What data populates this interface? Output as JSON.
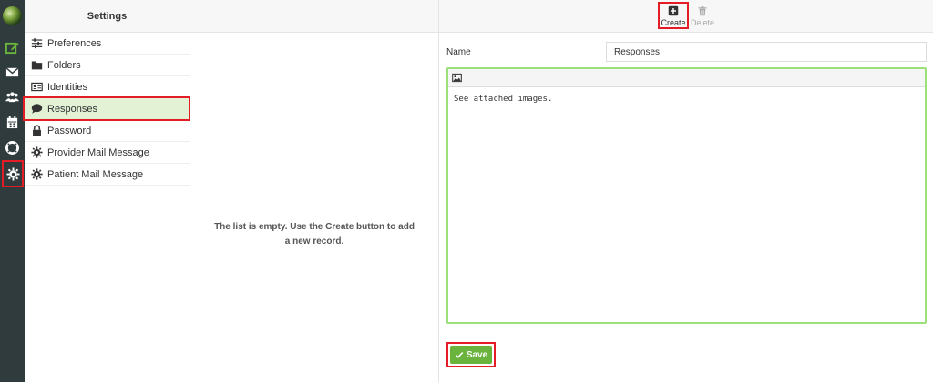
{
  "rail": {
    "items": [
      {
        "icon": "compose-icon",
        "color": "#6ab43e"
      },
      {
        "icon": "envelope-icon"
      },
      {
        "icon": "users-icon"
      },
      {
        "icon": "calendar-icon"
      },
      {
        "icon": "lifebuoy-icon"
      },
      {
        "icon": "gear-icon",
        "selected": true
      }
    ]
  },
  "settings": {
    "title": "Settings",
    "items": [
      {
        "label": "Preferences",
        "icon": "sliders-icon"
      },
      {
        "label": "Folders",
        "icon": "folder-icon"
      },
      {
        "label": "Identities",
        "icon": "id-card-icon"
      },
      {
        "label": "Responses",
        "icon": "comment-icon",
        "active": true
      },
      {
        "label": "Password",
        "icon": "lock-icon"
      },
      {
        "label": "Provider Mail Message",
        "icon": "gear-icon"
      },
      {
        "label": "Patient Mail Message",
        "icon": "gear-icon"
      }
    ]
  },
  "list": {
    "empty_message": "The list is empty. Use the Create button to add a new record."
  },
  "toolbar": {
    "create_label": "Create",
    "delete_label": "Delete"
  },
  "form": {
    "name_label": "Name",
    "name_value": "Responses",
    "body_text": "See attached images.",
    "save_label": "Save"
  },
  "colors": {
    "accent": "#6ab43e",
    "highlight": "#e31c25",
    "rail_bg": "#2f3b3d"
  }
}
